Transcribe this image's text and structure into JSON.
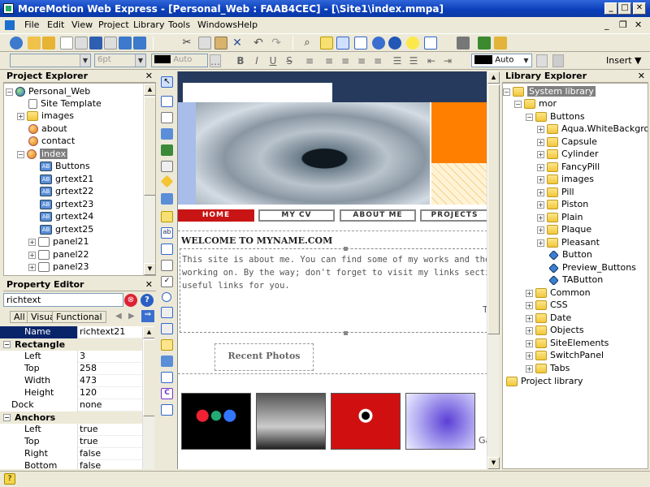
{
  "window": {
    "title": "MoreMotion Web Express - [Personal_Web : FAAB4CEC] - [\\Site1\\index.mmpa]"
  },
  "menu": [
    "File",
    "Edit",
    "View",
    "Project",
    "Library",
    "Tools",
    "Windows",
    "Help"
  ],
  "format_bar": {
    "font_size": "6pt",
    "color1": "Auto",
    "color2": "Auto",
    "insert": "Insert"
  },
  "project_explorer": {
    "title": "Project Explorer",
    "items": [
      "Personal_Web",
      "Site Template",
      "images",
      "about",
      "contact",
      "index",
      "Buttons",
      "grtext21",
      "grtext22",
      "grtext23",
      "grtext24",
      "grtext25",
      "panel21",
      "panel22",
      "panel23"
    ]
  },
  "property_editor": {
    "title": "Property Editor",
    "selected": "richtext",
    "tabs": [
      "All",
      "Visual",
      "Functional"
    ],
    "name_key": "Name",
    "name_val": "richtext21",
    "cat_rect": "Rectangle",
    "rect": [
      [
        "Left",
        "3"
      ],
      [
        "Top",
        "258"
      ],
      [
        "Width",
        "473"
      ],
      [
        "Height",
        "120"
      ]
    ],
    "dock": [
      "Dock",
      "none"
    ],
    "cat_anchors": "Anchors",
    "anchors": [
      [
        "Left",
        "true"
      ],
      [
        "Top",
        "true"
      ],
      [
        "Right",
        "false"
      ],
      [
        "Bottom",
        "false"
      ]
    ]
  },
  "canvas": {
    "nav": [
      "HOME",
      "MY CV",
      "ABOUT ME",
      "PROJECTS"
    ],
    "welcome": "WELCOME TO MYNAME.COM",
    "body_lines": [
      "This site is about me. You can find some of my works and the projects I a",
      "working on. By the way; don't forget to visit my links section. It has some",
      "useful links for you."
    ],
    "stray": "T",
    "recent": "Recent Photos",
    "stray2": "Ga"
  },
  "library_explorer": {
    "title": "Library Explorer",
    "items": [
      "System library",
      "mor",
      "Buttons",
      "Aqua.WhiteBackground",
      "Capsule",
      "Cylinder",
      "FancyPill",
      "images",
      "Pill",
      "Piston",
      "Plain",
      "Plaque",
      "Pleasant",
      "Button",
      "Preview_Buttons",
      "TAButton",
      "Common",
      "CSS",
      "Date",
      "Objects",
      "SiteElements",
      "SwitchPanel",
      "Tabs",
      "Project library"
    ]
  },
  "colors": {
    "title_bar": "#0a3db8",
    "accent_red": "#c81414",
    "orange": "#ff7f00",
    "header_navy": "#263a5e"
  }
}
